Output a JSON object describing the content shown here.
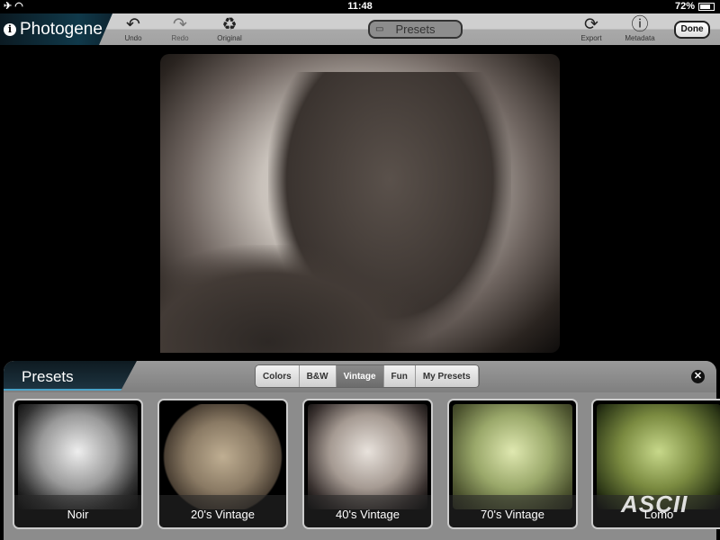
{
  "status": {
    "time": "11:48",
    "battery": "72%",
    "battery_level": 0.72
  },
  "toolbar": {
    "app_name": "Photogene",
    "undo": "Undo",
    "redo": "Redo",
    "original": "Original",
    "presets": "Presets",
    "export": "Export",
    "metadata": "Metadata",
    "done": "Done"
  },
  "panel": {
    "title": "Presets",
    "tabs": [
      "Colors",
      "B&W",
      "Vintage",
      "Fun",
      "My Presets"
    ],
    "active_tab": "Vintage",
    "presets": [
      {
        "label": "Noir"
      },
      {
        "label": "20's Vintage"
      },
      {
        "label": "40's Vintage"
      },
      {
        "label": "70's Vintage"
      },
      {
        "label": "Lomo"
      }
    ]
  },
  "watermark": "ASCII"
}
